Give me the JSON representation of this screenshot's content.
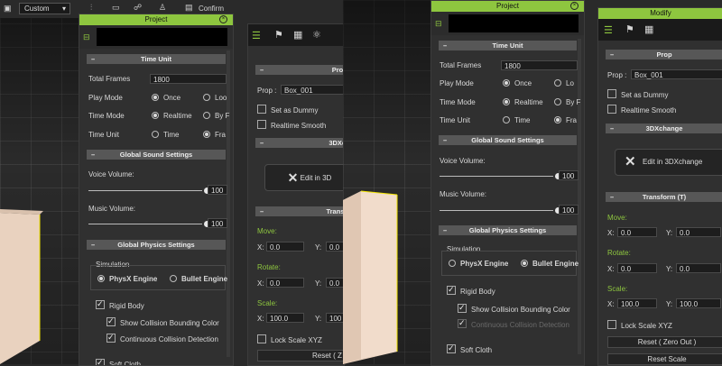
{
  "toolbar": {
    "preset": "Custom",
    "confirm_label": "Confirm"
  },
  "project": {
    "title": "Project",
    "time_unit_header": "Time Unit",
    "total_frames_label": "Total Frames",
    "total_frames_value": "1800",
    "play_mode_label": "Play Mode",
    "play_mode_once": "Once",
    "play_mode_loop": "Loop",
    "time_mode_label": "Time Mode",
    "time_mode_realtime": "Realtime",
    "time_mode_byframe": "By Frame",
    "time_unit_label": "Time Unit",
    "time_unit_time": "Time",
    "time_unit_frame": "Frame",
    "sound_header": "Global Sound Settings",
    "voice_label": "Voice Volume:",
    "voice_value": "100",
    "music_label": "Music Volume:",
    "music_value": "100",
    "physics_header": "Global Physics Settings",
    "simulation_label": "Simulation",
    "physx_label": "PhysX Engine",
    "bullet_label": "Bullet Engine",
    "rigid_body": "Rigid Body",
    "show_collision": "Show Collision Bounding Color",
    "continuous_collision": "Continuous Collision Detection",
    "soft_cloth": "Soft Cloth",
    "left_loop": "Loo",
    "left_byframe": "By F",
    "left_frame": "Fra",
    "right_loop": "Lo",
    "right_byframe": "By F",
    "right_frame": "Fra"
  },
  "modify": {
    "title": "Modify",
    "prop_header": "Prop",
    "prop_header_left": "Pro",
    "prop_label": "Prop :",
    "prop_value": "Box_001",
    "set_as_dummy": "Set as Dummy",
    "realtime_smooth": "Realtime Smooth",
    "threedx_header": "3DXchange",
    "threedx_header_left": "3DXch",
    "edit_button": "Edit in 3DXchange",
    "edit_button_left": "Edit in 3D",
    "transform_header": "Transform  (T)",
    "transform_header_left": "Transfo",
    "move_label": "Move:",
    "rotate_label": "Rotate:",
    "scale_label": "Scale:",
    "x_label": "X:",
    "y_label": "Y:",
    "move_x": "0.0",
    "move_y": "0.0",
    "rotate_x": "0.0",
    "rotate_y": "0.0",
    "scale_x": "100.0",
    "scale_y": "100.0",
    "scale_y_cut": "100",
    "lock_scale": "Lock Scale XYZ",
    "reset_button": "Reset ( Zero Out )",
    "reset_cut": "Reset ( Z",
    "reset_scale_button": "Reset Scale"
  },
  "colors": {
    "accent": "#8ec63f",
    "panel": "#303030",
    "section": "#575757"
  }
}
